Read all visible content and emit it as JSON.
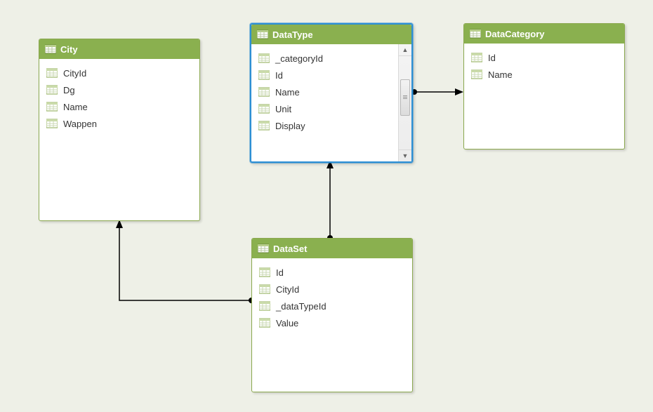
{
  "entities": {
    "city": {
      "title": "City",
      "fields": [
        "CityId",
        "Dg",
        "Name",
        "Wappen"
      ]
    },
    "dataType": {
      "title": "DataType",
      "fields": [
        "_categoryId",
        "Id",
        "Name",
        "Unit",
        "Display"
      ],
      "selected": true,
      "scrollable": true
    },
    "dataCategory": {
      "title": "DataCategory",
      "fields": [
        "Id",
        "Name"
      ]
    },
    "dataSet": {
      "title": "DataSet",
      "fields": [
        "Id",
        "CityId",
        "_dataTypeId",
        "Value"
      ]
    }
  },
  "relations": [
    {
      "from": "dataSet",
      "to": "city"
    },
    {
      "from": "dataSet",
      "to": "dataType"
    },
    {
      "from": "dataType",
      "to": "dataCategory"
    }
  ],
  "colors": {
    "background": "#eef0e7",
    "entityBorder": "#8aa84e",
    "headerFill": "#8ab04f",
    "selectedBorder": "#2d8fd4"
  }
}
